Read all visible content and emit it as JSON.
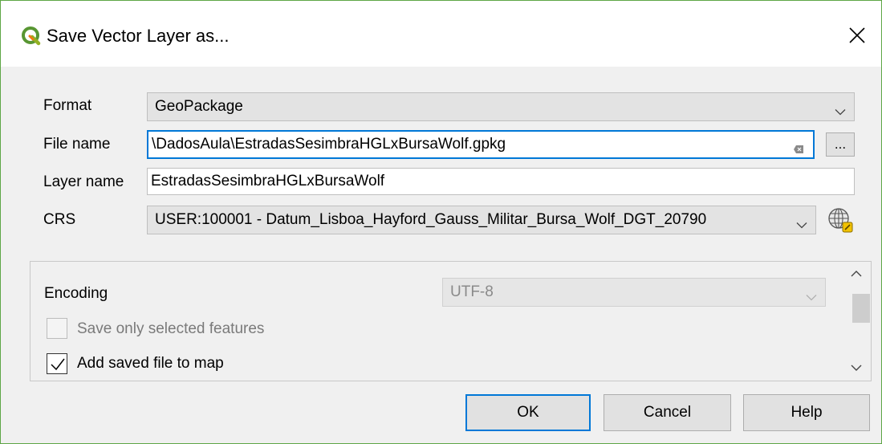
{
  "window": {
    "title": "Save Vector Layer as...",
    "app_icon": "qgis-logo-icon",
    "close_icon": "close-icon",
    "accent_color": "#5ea646"
  },
  "form": {
    "format": {
      "label": "Format",
      "value": "GeoPackage"
    },
    "file_name": {
      "label": "File name",
      "value": "\\DadosAula\\EstradasSesimbraHGLxBursaWolf.gpkg",
      "browse_label": "..."
    },
    "layer_name": {
      "label": "Layer name",
      "value": "EstradasSesimbraHGLxBursaWolf"
    },
    "crs": {
      "label": "CRS",
      "value": "USER:100001 - Datum_Lisboa_Hayford_Gauss_Militar_Bursa_Wolf_DGT_20790",
      "selector_icon": "globe-crs-icon"
    }
  },
  "options": {
    "encoding": {
      "label": "Encoding",
      "value": "UTF-8",
      "enabled": false
    },
    "save_selected": {
      "label": "Save only selected features",
      "checked": false,
      "enabled": false
    },
    "add_to_map": {
      "label": "Add saved file to map",
      "checked": true,
      "enabled": true
    }
  },
  "buttons": {
    "ok": "OK",
    "cancel": "Cancel",
    "help": "Help"
  }
}
